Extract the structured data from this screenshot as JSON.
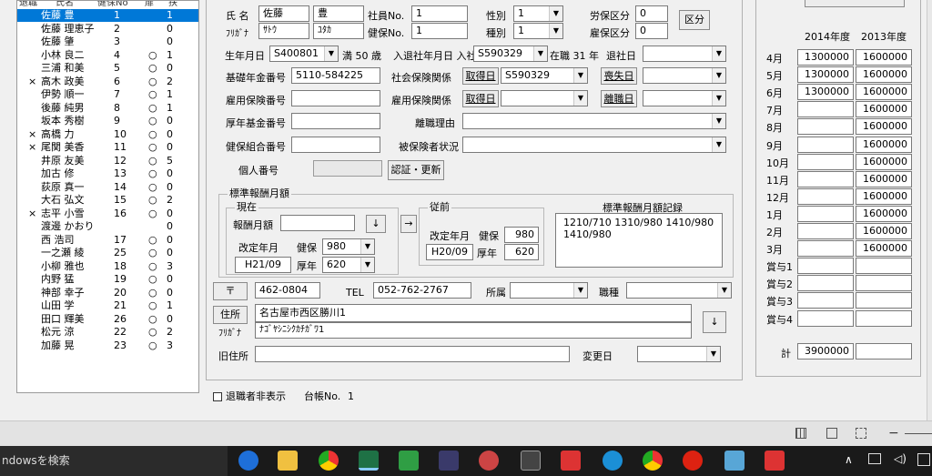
{
  "list": {
    "headers": {
      "col1": "退職",
      "col2": "氏名",
      "col3": "健保No",
      "col4": "扉",
      "col5": "扶"
    },
    "rows": [
      {
        "mark": "",
        "name": "佐藤 豊",
        "no": "1",
        "flag": "",
        "fu": "1",
        "selected": true
      },
      {
        "mark": "",
        "name": "佐藤 理恵子",
        "no": "2",
        "flag": "",
        "fu": "0"
      },
      {
        "mark": "",
        "name": "佐藤 肇",
        "no": "3",
        "flag": "",
        "fu": "0"
      },
      {
        "mark": "",
        "name": "小林 良二",
        "no": "4",
        "flag": "○",
        "fu": "1"
      },
      {
        "mark": "",
        "name": "三浦 和美",
        "no": "5",
        "flag": "○",
        "fu": "0"
      },
      {
        "mark": "×",
        "name": "高木 政美",
        "no": "6",
        "flag": "○",
        "fu": "2"
      },
      {
        "mark": "",
        "name": "伊勢 順一",
        "no": "7",
        "flag": "○",
        "fu": "1"
      },
      {
        "mark": "",
        "name": "後藤 純男",
        "no": "8",
        "flag": "○",
        "fu": "1"
      },
      {
        "mark": "",
        "name": "坂本 秀樹",
        "no": "9",
        "flag": "○",
        "fu": "0"
      },
      {
        "mark": "×",
        "name": "高橋 力",
        "no": "10",
        "flag": "○",
        "fu": "0"
      },
      {
        "mark": "×",
        "name": "尾関 美香",
        "no": "11",
        "flag": "○",
        "fu": "0"
      },
      {
        "mark": "",
        "name": "井原 友美",
        "no": "12",
        "flag": "○",
        "fu": "5"
      },
      {
        "mark": "",
        "name": "加古 修",
        "no": "13",
        "flag": "○",
        "fu": "0"
      },
      {
        "mark": "",
        "name": "荻原 真一",
        "no": "14",
        "flag": "○",
        "fu": "0"
      },
      {
        "mark": "",
        "name": "大石 弘文",
        "no": "15",
        "flag": "○",
        "fu": "2"
      },
      {
        "mark": "×",
        "name": "志平 小雪",
        "no": "16",
        "flag": "○",
        "fu": "0"
      },
      {
        "mark": "",
        "name": "渡邊 かおり",
        "no": "",
        "flag": "",
        "fu": "0"
      },
      {
        "mark": "",
        "name": "西 浩司",
        "no": "17",
        "flag": "○",
        "fu": "0"
      },
      {
        "mark": "",
        "name": "一之瀬 綾",
        "no": "25",
        "flag": "○",
        "fu": "0"
      },
      {
        "mark": "",
        "name": "小柳 雅也",
        "no": "18",
        "flag": "○",
        "fu": "3"
      },
      {
        "mark": "",
        "name": "内野 猛",
        "no": "19",
        "flag": "○",
        "fu": "0"
      },
      {
        "mark": "",
        "name": "神部 幸子",
        "no": "20",
        "flag": "○",
        "fu": "0"
      },
      {
        "mark": "",
        "name": "山田 学",
        "no": "21",
        "flag": "○",
        "fu": "1"
      },
      {
        "mark": "",
        "name": "田口 輝美",
        "no": "26",
        "flag": "○",
        "fu": "0"
      },
      {
        "mark": "",
        "name": "松元 涼",
        "no": "22",
        "flag": "○",
        "fu": "2"
      },
      {
        "mark": "",
        "name": "加藤 晃",
        "no": "23",
        "flag": "○",
        "fu": "3"
      }
    ]
  },
  "form": {
    "name_label": "氏 名",
    "last_name": "佐藤",
    "first_name": "豊",
    "kana_label": "ﾌﾘｶﾞﾅ",
    "last_kana": "ｻﾄｳ",
    "first_kana": "ﾕﾀｶ",
    "emp_no_label": "社員No.",
    "emp_no": "1",
    "health_no_label": "健保No.",
    "health_no": "1",
    "gender_label": "性別",
    "gender": "1",
    "kind_label": "種別",
    "kind": "1",
    "labor_label": "労保区分",
    "labor": "0",
    "employ_label": "雇保区分",
    "employ": "0",
    "kubun_button": "区分",
    "birth_label": "生年月日",
    "birth": "S400801",
    "age_label": "満 50 歳",
    "join_label": "入退社年月日 入社",
    "join": "S590329",
    "tenure": "在職 31 年",
    "retire_label": "退社日",
    "retire": "",
    "pension_label": "基礎年金番号",
    "pension": "5110-584225",
    "social_label": "社会保険関係",
    "acquire_btn": "取得日",
    "social_acquire": "S590329",
    "loss_btn": "喪失日",
    "social_loss": "",
    "emp_ins_label": "雇用保険番号",
    "emp_ins": "",
    "emp_rel_label": "雇用保険関係",
    "emp_acquire": "",
    "emp_leave_btn": "離職日",
    "emp_leave": "",
    "welfare_label": "厚年基金番号",
    "welfare": "",
    "reason_label": "離職理由",
    "reason": "",
    "union_label": "健保組合番号",
    "union": "",
    "insured_label": "被保険者状況",
    "insured": "",
    "mynumber_label": "個人番号",
    "auth_button": "認証・更新",
    "reward_group": "標準報酬月額",
    "current_group": "現在",
    "reward_label": "報酬月額",
    "reward_val": "",
    "down_btn": "↓",
    "revise_label": "改定年月",
    "revise": "H21/09",
    "kenpo_label": "健保",
    "kenpo": "980",
    "kounen_label": "厚年",
    "kounen": "620",
    "arrow_btn": "→",
    "prev_group": "従前",
    "prev_revise_label": "改定年月",
    "prev_revise": "H20/09",
    "prev_kenpo_label": "健保",
    "prev_kenpo": "980",
    "prev_kounen_label": "厚年",
    "prev_kounen": "620",
    "record_label": "標準報酬月額記録",
    "record_line1": "1210/710  1310/980 1410/980",
    "record_line2": "1410/980",
    "zip_btn": "〒",
    "zip": "462-0804",
    "tel_label": "TEL",
    "tel": "052-762-2767",
    "dept_label": "所属",
    "dept": "",
    "job_label": "職種",
    "job": "",
    "addr_btn": "住所",
    "address": "名古屋市西区勝川1",
    "addr_kana_label": "ﾌﾘｶﾞﾅ",
    "addr_kana": "ﾅｺﾞﾔｼﾆｼｸｶﾁｶﾞﾜ1",
    "addr_down": "↓",
    "old_addr_label": "旧住所",
    "old_addr": "",
    "change_label": "変更日",
    "change": ""
  },
  "footer": {
    "hide_retired": "退職者非表示",
    "ledger_label": "台帳No.",
    "ledger_no": "1"
  },
  "monthly": {
    "col1": "2014年度",
    "col2": "2013年度",
    "rows": [
      {
        "m": "4月",
        "a": "1300000",
        "b": "1600000"
      },
      {
        "m": "5月",
        "a": "1300000",
        "b": "1600000"
      },
      {
        "m": "6月",
        "a": "1300000",
        "b": "1600000"
      },
      {
        "m": "7月",
        "a": "",
        "b": "1600000"
      },
      {
        "m": "8月",
        "a": "",
        "b": "1600000"
      },
      {
        "m": "9月",
        "a": "",
        "b": "1600000"
      },
      {
        "m": "10月",
        "a": "",
        "b": "1600000"
      },
      {
        "m": "11月",
        "a": "",
        "b": "1600000"
      },
      {
        "m": "12月",
        "a": "",
        "b": "1600000"
      },
      {
        "m": "1月",
        "a": "",
        "b": "1600000"
      },
      {
        "m": "2月",
        "a": "",
        "b": "1600000"
      },
      {
        "m": "3月",
        "a": "",
        "b": "1600000"
      },
      {
        "m": "賞与1",
        "a": "",
        "b": ""
      },
      {
        "m": "賞与2",
        "a": "",
        "b": ""
      },
      {
        "m": "賞与3",
        "a": "",
        "b": ""
      },
      {
        "m": "賞与4",
        "a": "",
        "b": ""
      }
    ],
    "total_label": "計",
    "total_a": "3900000",
    "total_b": ""
  },
  "taskbar": {
    "search": "ndowsを検索"
  }
}
